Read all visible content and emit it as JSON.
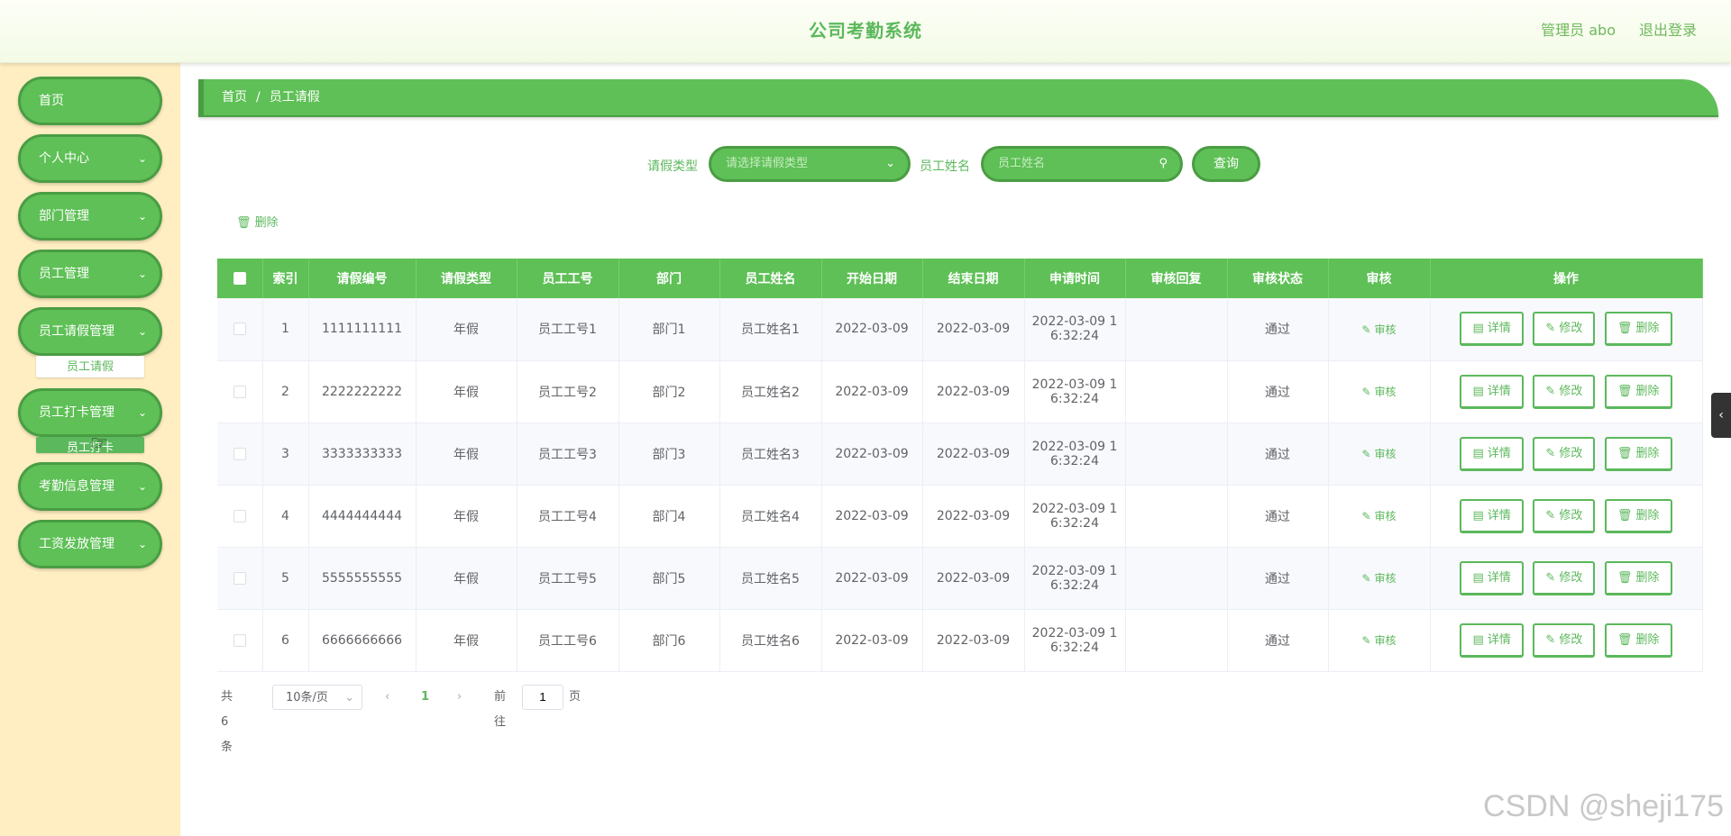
{
  "header": {
    "title": "公司考勤系统",
    "user": "管理员 abo",
    "logout": "退出登录"
  },
  "sidebar": {
    "items": [
      {
        "label": "首页",
        "chevron": false
      },
      {
        "label": "个人中心",
        "chevron": true
      },
      {
        "label": "部门管理",
        "chevron": true
      },
      {
        "label": "员工管理",
        "chevron": true
      },
      {
        "label": "员工请假管理",
        "chevron": true
      },
      {
        "label": "员工打卡管理",
        "chevron": true
      },
      {
        "label": "考勤信息管理",
        "chevron": true
      },
      {
        "label": "工资发放管理",
        "chevron": true
      }
    ],
    "sub_leave": "员工请假",
    "sub_clock": "员工打卡"
  },
  "breadcrumb": {
    "home": "首页",
    "sep": "/",
    "current": "员工请假"
  },
  "search": {
    "leave_type_label": "请假类型",
    "leave_type_placeholder": "请选择请假类型",
    "name_label": "员工姓名",
    "name_placeholder": "员工姓名",
    "query_label": "查询"
  },
  "bulk_delete_label": "删除",
  "table": {
    "columns": [
      "索引",
      "请假编号",
      "请假类型",
      "员工工号",
      "部门",
      "员工姓名",
      "开始日期",
      "结束日期",
      "申请时间",
      "审核回复",
      "审核状态",
      "审核",
      "操作"
    ],
    "rows": [
      {
        "idx": "1",
        "code": "1111111111",
        "type": "年假",
        "emp_no": "员工工号1",
        "dept": "部门1",
        "name": "员工姓名1",
        "start": "2022-03-09",
        "end": "2022-03-09",
        "apply_1": "2022-03-09 1",
        "apply_2": "6:32:24",
        "reply": "",
        "status": "通过"
      },
      {
        "idx": "2",
        "code": "2222222222",
        "type": "年假",
        "emp_no": "员工工号2",
        "dept": "部门2",
        "name": "员工姓名2",
        "start": "2022-03-09",
        "end": "2022-03-09",
        "apply_1": "2022-03-09 1",
        "apply_2": "6:32:24",
        "reply": "",
        "status": "通过"
      },
      {
        "idx": "3",
        "code": "3333333333",
        "type": "年假",
        "emp_no": "员工工号3",
        "dept": "部门3",
        "name": "员工姓名3",
        "start": "2022-03-09",
        "end": "2022-03-09",
        "apply_1": "2022-03-09 1",
        "apply_2": "6:32:24",
        "reply": "",
        "status": "通过"
      },
      {
        "idx": "4",
        "code": "4444444444",
        "type": "年假",
        "emp_no": "员工工号4",
        "dept": "部门4",
        "name": "员工姓名4",
        "start": "2022-03-09",
        "end": "2022-03-09",
        "apply_1": "2022-03-09 1",
        "apply_2": "6:32:24",
        "reply": "",
        "status": "通过"
      },
      {
        "idx": "5",
        "code": "5555555555",
        "type": "年假",
        "emp_no": "员工工号5",
        "dept": "部门5",
        "name": "员工姓名5",
        "start": "2022-03-09",
        "end": "2022-03-09",
        "apply_1": "2022-03-09 1",
        "apply_2": "6:32:24",
        "reply": "",
        "status": "通过"
      },
      {
        "idx": "6",
        "code": "6666666666",
        "type": "年假",
        "emp_no": "员工工号6",
        "dept": "部门6",
        "name": "员工姓名6",
        "start": "2022-03-09",
        "end": "2022-03-09",
        "apply_1": "2022-03-09 1",
        "apply_2": "6:32:24",
        "reply": "",
        "status": "通过"
      }
    ],
    "audit_label": "审核",
    "op_detail": "详情",
    "op_edit": "修改",
    "op_delete": "删除"
  },
  "pagination": {
    "total": "共 6 条",
    "page_size": "10条/页",
    "current": "1",
    "goto_prefix": "前往",
    "goto_value": "1",
    "goto_suffix": "页"
  },
  "watermark": "CSDN @sheji175",
  "colors": {
    "primary": "#5ec056",
    "primary_dark": "#4a9d43",
    "sidebar_bg": "#ffeec2"
  },
  "icons": {
    "chevron": "chevron-down-icon",
    "search": "search-icon",
    "delete": "trash-icon",
    "edit": "edit-icon",
    "detail": "document-icon"
  }
}
